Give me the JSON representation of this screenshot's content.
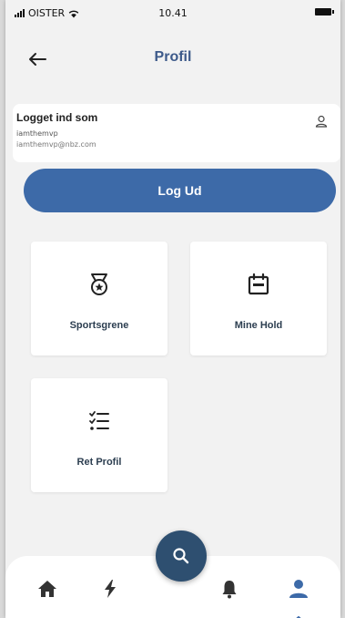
{
  "status_bar": {
    "carrier": "OISTER",
    "time": "10.41"
  },
  "header": {
    "title": "Profil",
    "back_icon": "arrow-left-icon"
  },
  "login_card": {
    "heading": "Logget ind som",
    "username": "iamthemvp",
    "email": "iamthemvp@nbz.com",
    "icon": "user-outline-icon"
  },
  "logout_button": {
    "label": "Log Ud"
  },
  "tiles": [
    {
      "label": "Sportsgrene",
      "icon": "medal-icon"
    },
    {
      "label": "Mine Hold",
      "icon": "calendar-icon"
    },
    {
      "label": "Ret Profil",
      "icon": "checklist-icon"
    }
  ],
  "fab": {
    "icon": "search-icon"
  },
  "bottom_nav": {
    "items": [
      {
        "icon": "home-icon"
      },
      {
        "icon": "lightning-icon"
      },
      {
        "icon": "bell-icon"
      },
      {
        "icon": "user-icon",
        "active": true
      }
    ]
  },
  "colors": {
    "accent": "#3d6aa8",
    "title": "#3d5a8a",
    "dark": "#2e4f70"
  }
}
